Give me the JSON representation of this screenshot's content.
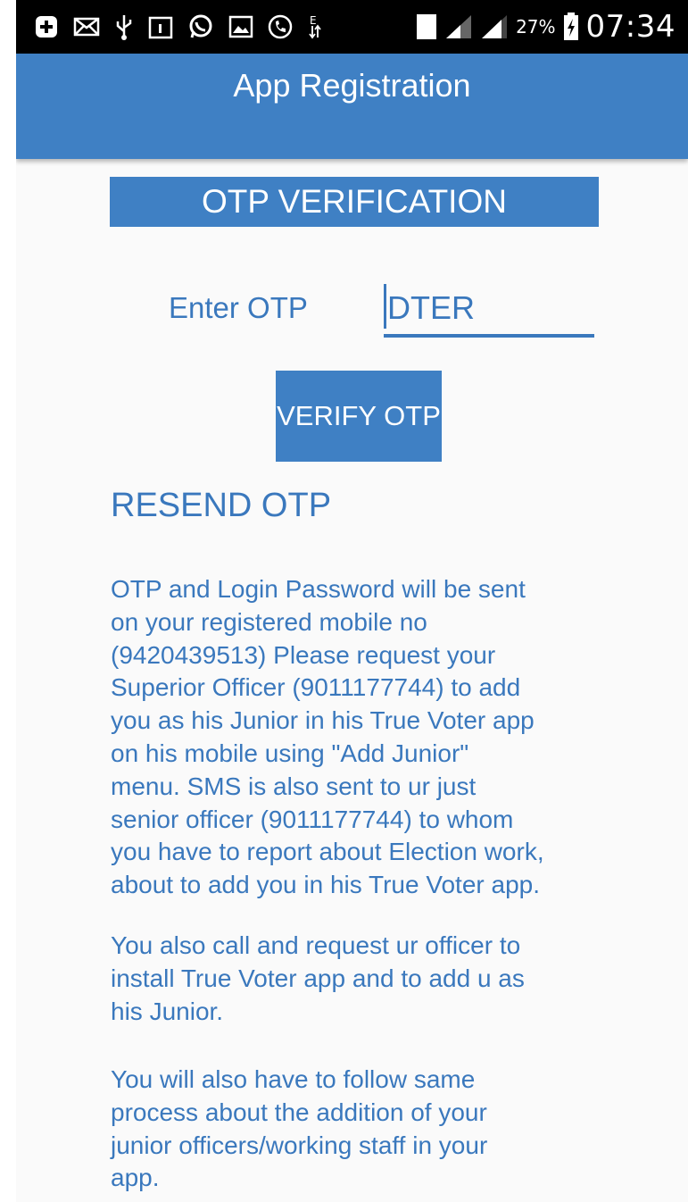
{
  "status_bar": {
    "icons": [
      "add-box-icon",
      "mail-icon",
      "usb-icon",
      "calendar-icon",
      "whatsapp-icon",
      "image-icon",
      "call-icon",
      "data-transfer-icon",
      "sim-1-icon",
      "signal-1-icon",
      "signal-2-icon",
      "battery-charging-icon"
    ],
    "sim_label": "1",
    "battery_percent": "27%",
    "time": "07:34"
  },
  "app_bar": {
    "title": "App Registration",
    "color": "#3f80c4"
  },
  "otp_section": {
    "banner": "OTP VERIFICATION",
    "label": "Enter OTP",
    "input_placeholder": "DTER",
    "verify_button": "VERIFY OTP",
    "resend_link": "RESEND OTP"
  },
  "info": {
    "paragraph_1": "OTP and Login Password will be sent\non your registered mobile no\n(9420439513) Please request your\nSuperior Officer (9011177744) to add\nyou as his Junior in his True Voter app\non his mobile using \"Add Junior\"\nmenu. SMS is also sent to ur just\nsenior officer  (9011177744) to whom\nyou have to report about Election work,\nabout to add you in his True Voter app.",
    "paragraph_2": " You also call and request ur officer to\ninstall True Voter app and to add u as\nhis Junior.",
    "paragraph_3": " You will also have to follow same\nprocess about the addition of your\njunior officers/working staff in your\napp."
  },
  "colors": {
    "accent": "#3f80c4",
    "text": "#3a78bd",
    "background": "#fafafa"
  }
}
